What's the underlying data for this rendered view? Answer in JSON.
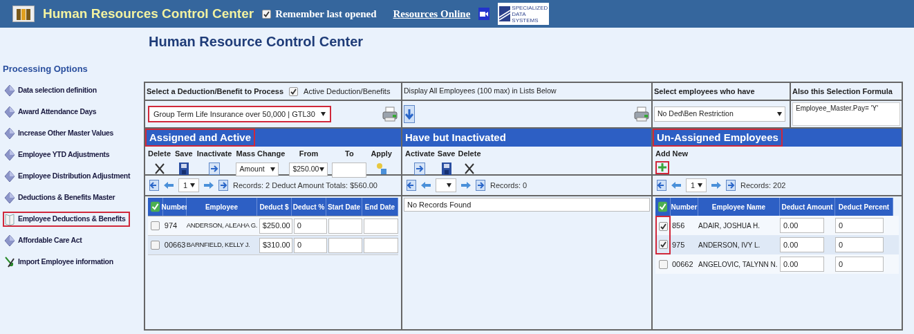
{
  "app_bar": {
    "title": "Human Resources Control Center",
    "remember": {
      "label": "Remember last opened",
      "checked": true
    },
    "link": "Resources Online",
    "logo_text": [
      "SPECIALIZED",
      "DATA",
      "SYSTEMS"
    ]
  },
  "page_title": "Human Resource Control Center",
  "sidebar": {
    "heading": "Processing Options",
    "items": [
      {
        "label": "Data selection definition",
        "kind": "gem",
        "selected": false
      },
      {
        "label": "Award Attendance Days",
        "kind": "gem",
        "selected": false
      },
      {
        "label": "Increase Other Master Values",
        "kind": "gem",
        "selected": false
      },
      {
        "label": "Employee YTD Adjustments",
        "kind": "gem",
        "selected": false
      },
      {
        "label": "Employee Distribution Adjustment",
        "kind": "gem",
        "selected": false
      },
      {
        "label": "Deductions & Benefits Master",
        "kind": "gem",
        "selected": false
      },
      {
        "label": "Employee Deductions & Benefits",
        "kind": "book",
        "selected": true
      },
      {
        "label": "Affordable Care Act",
        "kind": "gem",
        "selected": false
      },
      {
        "label": "Import Employee information",
        "kind": "import",
        "selected": false
      }
    ]
  },
  "assigned": {
    "select_label": "Select a Deduction/Benefit to Process",
    "active_filter": {
      "label": "Active Deduction/Benefits",
      "checked": true
    },
    "deduction": {
      "value": "Group Term Life Insurance over 50,000 | GTL30",
      "highlighted": true
    },
    "title": "Assigned and Active",
    "title_highlighted": true,
    "actions": [
      {
        "label": "Delete",
        "kind": "delete"
      },
      {
        "label": "Save",
        "kind": "save"
      },
      {
        "label": "Inactivate",
        "kind": "move"
      }
    ],
    "mass_change": {
      "label": "Mass Change",
      "value": "Amount"
    },
    "from": {
      "label": "From",
      "value": "$250.00"
    },
    "to": {
      "label": "To"
    },
    "apply": {
      "label": "Apply"
    },
    "pager": {
      "page": "1",
      "summary": "Records: 2 Deduct Amount Totals: $560.00"
    },
    "columns": [
      "Number",
      "Employee",
      "Deduct $",
      "Deduct %",
      "Start Date",
      "End Date"
    ],
    "rows": [
      {
        "checked": false,
        "number": "974",
        "employee": "ANDERSON, ALEAHA G.",
        "deduct_amount": "$250.00",
        "deduct_percent": "0"
      },
      {
        "checked": false,
        "number": "00663",
        "employee": "BARNFIELD, KELLY J.",
        "deduct_amount": "$310.00",
        "deduct_percent": "0"
      }
    ]
  },
  "inactivated": {
    "display_label": "Display All Employees (100 max) in Lists Below",
    "title": "Have but Inactivated",
    "actions": [
      {
        "label": "Activate",
        "kind": "move"
      },
      {
        "label": "Save",
        "kind": "save"
      },
      {
        "label": "Delete",
        "kind": "delete"
      }
    ],
    "pager": {
      "summary": "Records: 0"
    },
    "empty_text": "No Records Found"
  },
  "unassigned": {
    "filter_label": "Select employees who have",
    "filter_value": "No Ded\\Ben Restriction",
    "formula_label": "Also this Selection Formula",
    "formula_value": "Employee_Master.Pay= 'Y'",
    "title": "Un-Assigned Employees",
    "title_highlighted": true,
    "add": {
      "label": "Add New",
      "highlighted": true
    },
    "pager": {
      "page": "1",
      "summary": "Records: 202"
    },
    "columns": [
      "Number",
      "Employee Name",
      "Deduct Amount",
      "Deduct Percent"
    ],
    "rows": [
      {
        "checked": true,
        "highlighted": true,
        "number": "856",
        "employee": "ADAIR, JOSHUA H.",
        "deduct_amount": "0.00",
        "deduct_percent": "0"
      },
      {
        "checked": true,
        "highlighted": true,
        "number": "975",
        "employee": "ANDERSON, IVY L.",
        "deduct_amount": "0.00",
        "deduct_percent": "0"
      },
      {
        "checked": false,
        "highlighted": false,
        "number": "00662",
        "employee": "ANGELOVIC, TALYNN N.",
        "deduct_amount": "0.00",
        "deduct_percent": "0"
      }
    ]
  }
}
